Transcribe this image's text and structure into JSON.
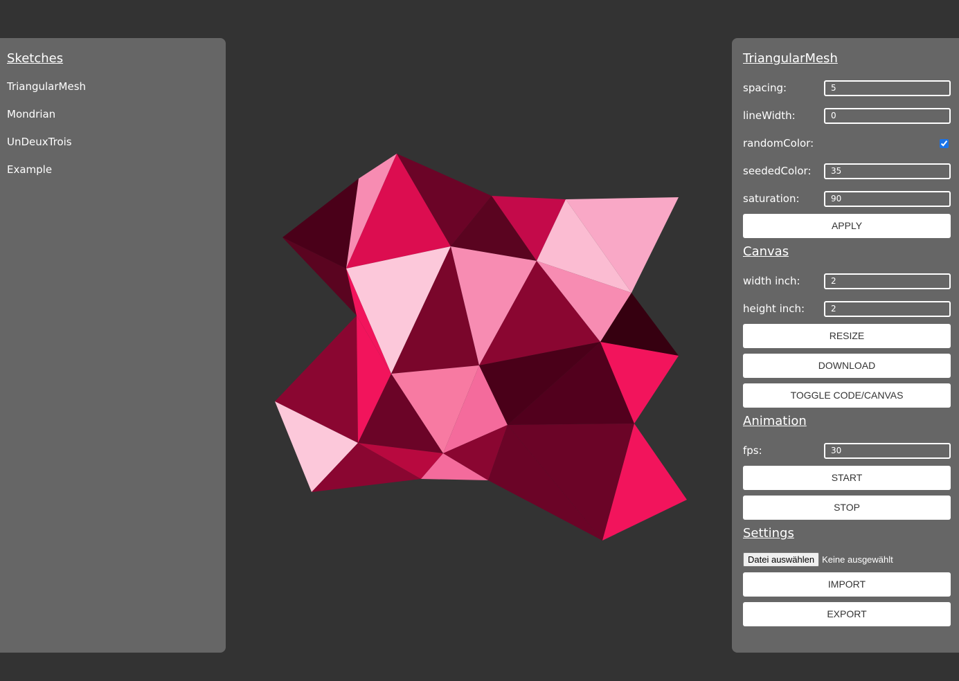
{
  "sketches": {
    "title": "Sketches",
    "items": [
      "TriangularMesh",
      "Mondrian",
      "UnDeuxTrois",
      "Example"
    ]
  },
  "params": {
    "title": "TriangularMesh",
    "spacing_label": "spacing:",
    "spacing_value": "5",
    "linewidth_label": "lineWidth:",
    "linewidth_value": "0",
    "randomcolor_label": "randomColor:",
    "randomcolor_checked": true,
    "seededcolor_label": "seededColor:",
    "seededcolor_value": "35",
    "saturation_label": "saturation:",
    "saturation_value": "90",
    "apply_label": "APPLY"
  },
  "canvas": {
    "title": "Canvas",
    "width_label": "width inch:",
    "width_value": "2",
    "height_label": "height inch:",
    "height_value": "2",
    "resize_label": "RESIZE",
    "download_label": "DOWNLOAD",
    "toggle_label": "TOGGLE CODE/CANVAS"
  },
  "animation": {
    "title": "Animation",
    "fps_label": "fps:",
    "fps_value": "30",
    "start_label": "START",
    "stop_label": "STOP"
  },
  "settings": {
    "title": "Settings",
    "file_button_label": "Datei auswählen",
    "file_status": "Keine ausgewählt",
    "import_label": "IMPORT",
    "export_label": "EXPORT"
  },
  "colors": {
    "background": "#333333",
    "panel": "#666666",
    "button": "#ffffff",
    "mesh_palette": [
      "#4a0019",
      "#6b0427",
      "#8a0631",
      "#c40a4a",
      "#dc0d50",
      "#f2145c",
      "#f77aa2",
      "#f78cb2",
      "#f9a8c6",
      "#fcc8da"
    ]
  }
}
